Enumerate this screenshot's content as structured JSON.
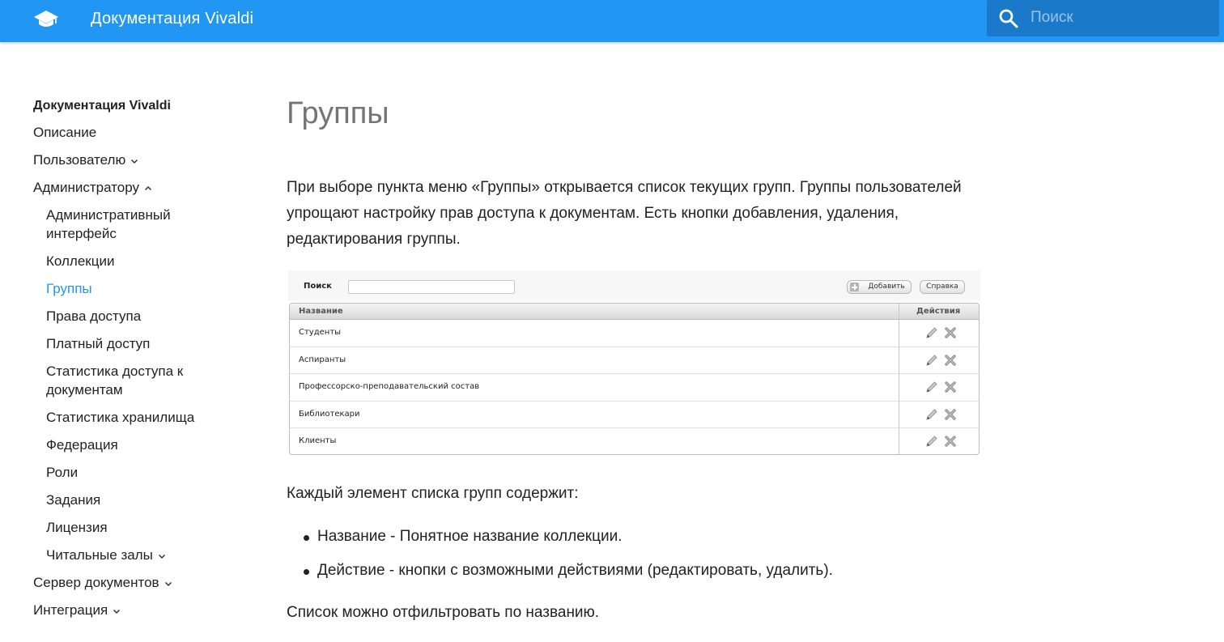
{
  "header": {
    "title": "Документация Vivaldi",
    "search_placeholder": "Поиск",
    "logo_icon": "graduation-cap-icon",
    "brand_color": "#2196f3"
  },
  "sidebar": {
    "heading": "Документация Vivaldi",
    "items": [
      {
        "label": "Описание",
        "level": 1,
        "chevron": ""
      },
      {
        "label": "Пользователю",
        "level": 1,
        "chevron": "down"
      },
      {
        "label": "Администратору",
        "level": 1,
        "chevron": "up"
      },
      {
        "label": "Административный интерфейс",
        "level": 2,
        "chevron": ""
      },
      {
        "label": "Коллекции",
        "level": 2,
        "chevron": ""
      },
      {
        "label": "Группы",
        "level": 2,
        "chevron": "",
        "active": true
      },
      {
        "label": "Права доступа",
        "level": 2,
        "chevron": ""
      },
      {
        "label": "Платный доступ",
        "level": 2,
        "chevron": ""
      },
      {
        "label": "Статистика доступа к документам",
        "level": 2,
        "chevron": ""
      },
      {
        "label": "Статистика хранилища",
        "level": 2,
        "chevron": ""
      },
      {
        "label": "Федерация",
        "level": 2,
        "chevron": ""
      },
      {
        "label": "Роли",
        "level": 2,
        "chevron": ""
      },
      {
        "label": "Задания",
        "level": 2,
        "chevron": ""
      },
      {
        "label": "Лицензия",
        "level": 2,
        "chevron": ""
      },
      {
        "label": "Читальные залы",
        "level": 2,
        "chevron": "down"
      },
      {
        "label": "Сервер документов",
        "level": 1,
        "chevron": "down"
      },
      {
        "label": "Интеграция",
        "level": 1,
        "chevron": "down"
      }
    ]
  },
  "main": {
    "title": "Группы",
    "intro": "При выборе пункта меню «Группы» открывается список текущих групп. Группы пользователей упрощают настройку прав доступа к документам. Есть кнопки добавления, удаления, редактирования группы.",
    "list_intro": "Каждый элемент списка групп содержит:",
    "bullets": [
      "Название - Понятное название коллекции.",
      "Действие - кнопки с возможными действиями (редактировать, удалить)."
    ],
    "outro": "Список можно отфильтровать по названию."
  },
  "screenshot": {
    "search_label": "Поиск",
    "add_button": "Добавить",
    "help_button": "Справка",
    "columns": [
      "Название",
      "Действия"
    ],
    "rows": [
      "Студенты",
      "Аспиранты",
      "Профессорско-преподавательский состав",
      "Библиотекари",
      "Клиенты"
    ]
  }
}
